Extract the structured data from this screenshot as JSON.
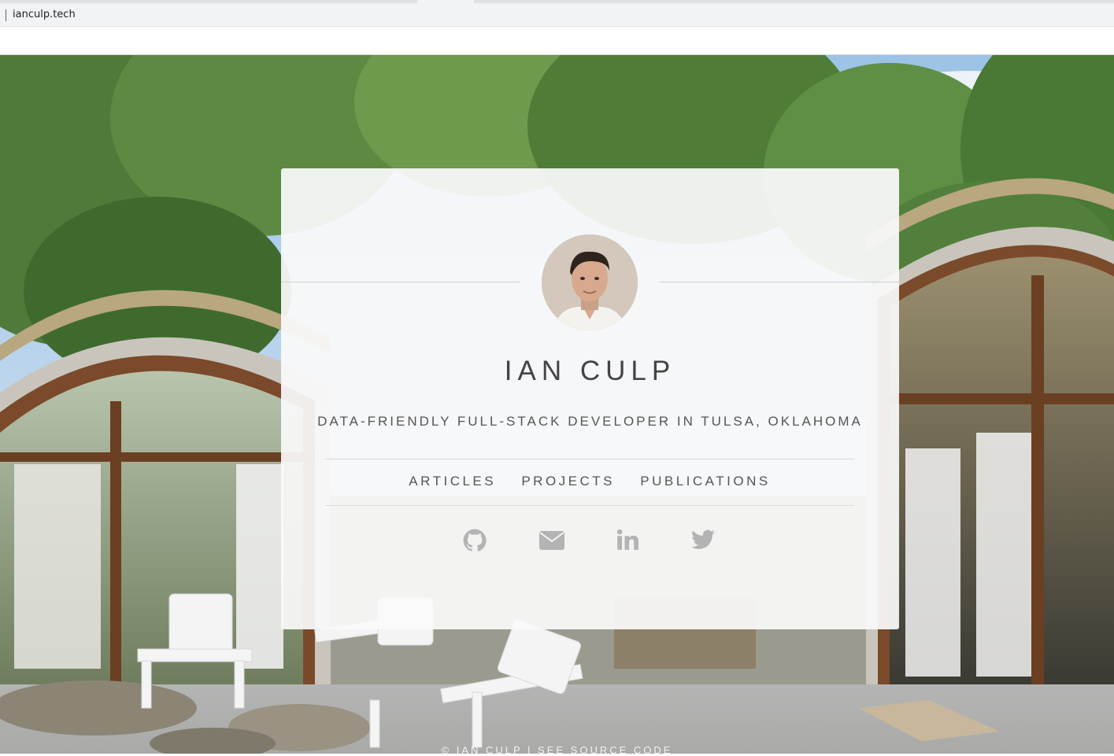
{
  "browser": {
    "url": "ianculp.tech"
  },
  "profile": {
    "name": "IAN CULP",
    "tagline": "DATA-FRIENDLY FULL-STACK DEVELOPER IN TULSA, OKLAHOMA"
  },
  "nav": {
    "articles": "ARTICLES",
    "projects": "PROJECTS",
    "publications": "PUBLICATIONS"
  },
  "social": {
    "icons": [
      "github-icon",
      "envelope-icon",
      "linkedin-icon",
      "twitter-icon"
    ],
    "icon_color": "#b3b3b3"
  },
  "footer": {
    "text": "© IAN CULP | SEE SOURCE CODE"
  },
  "colors": {
    "card_bg": "#fafafa",
    "text": "#444444",
    "rule": "#cfcfcf"
  }
}
